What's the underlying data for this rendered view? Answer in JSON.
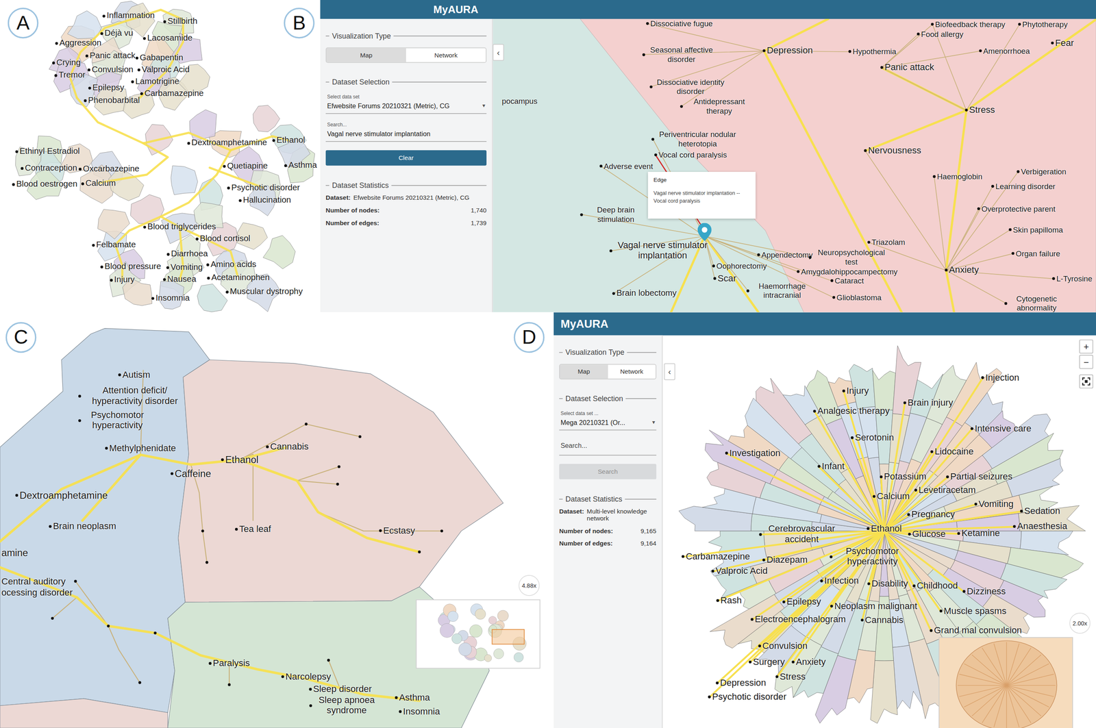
{
  "panel_a": {
    "badge": "A",
    "nodes": [
      {
        "label": "Inflammation"
      },
      {
        "label": "Stillbirth"
      },
      {
        "label": "Déjà vu"
      },
      {
        "label": "Lacosamide"
      },
      {
        "label": "Aggression"
      },
      {
        "label": "Panic attack"
      },
      {
        "label": "Gabapentin"
      },
      {
        "label": "Crying"
      },
      {
        "label": "Convulsion"
      },
      {
        "label": "Valproic Acid"
      },
      {
        "label": "Tremor"
      },
      {
        "label": "Lamotrigine"
      },
      {
        "label": "Epilepsy"
      },
      {
        "label": "Carbamazepine"
      },
      {
        "label": "Phenobarbital"
      },
      {
        "label": "Dextroamphetamine"
      },
      {
        "label": "Ethanol"
      },
      {
        "label": "Ethinyl Estradiol"
      },
      {
        "label": "Quetiapine"
      },
      {
        "label": "Asthma"
      },
      {
        "label": "Contraception"
      },
      {
        "label": "Oxcarbazepine"
      },
      {
        "label": "Blood oestrogen"
      },
      {
        "label": "Calcium"
      },
      {
        "label": "Psychotic disorder"
      },
      {
        "label": "Hallucination"
      },
      {
        "label": "Blood triglycerides"
      },
      {
        "label": "Blood cortisol"
      },
      {
        "label": "Felbamate"
      },
      {
        "label": "Diarrhoea"
      },
      {
        "label": "Amino acids"
      },
      {
        "label": "Blood pressure"
      },
      {
        "label": "Vomiting"
      },
      {
        "label": "Injury"
      },
      {
        "label": "Nausea"
      },
      {
        "label": "Acetaminophen"
      },
      {
        "label": "Insomnia"
      },
      {
        "label": "Muscular dystrophy"
      }
    ]
  },
  "panel_b": {
    "badge": "B",
    "header": {
      "title": "MyAURA"
    },
    "collapse_icon": "‹",
    "sidebar": {
      "visualization": {
        "legend": "Visualization Type",
        "tabs": [
          {
            "label": "Map",
            "selected": true
          },
          {
            "label": "Network",
            "selected": false
          }
        ]
      },
      "dataset": {
        "legend": "Dataset Selection",
        "select_label": "Select data set",
        "select_value": "Efwebsite Forums 20210321 (Metric), CG",
        "select_arrow": "▾",
        "search_label": "Search...",
        "search_value": "Vagal nerve stimulator implantation",
        "button": {
          "label": "Clear",
          "disabled": false
        }
      },
      "stats": {
        "legend": "Dataset Statistics",
        "rows": [
          {
            "label": "Dataset:",
            "value": "Efwebsite Forums 20210321 (Metric), CG"
          },
          {
            "label": "Number of nodes:",
            "value": "1,740"
          },
          {
            "label": "Number of edges:",
            "value": "1,739"
          }
        ]
      }
    },
    "map": {
      "nodes": [
        {
          "label": "pocampus"
        },
        {
          "label": "Dissociative fugue"
        },
        {
          "label": "Seasonal affective disorder"
        },
        {
          "label": "Depression"
        },
        {
          "label": "Hypothermia"
        },
        {
          "label": "Biofeedback therapy"
        },
        {
          "label": "Food allergy"
        },
        {
          "label": "Phytotherapy"
        },
        {
          "label": "Panic attack"
        },
        {
          "label": "Amenorrhoea"
        },
        {
          "label": "Fear"
        },
        {
          "label": "Dissociative identity disorder"
        },
        {
          "label": "Antidepressant therapy"
        },
        {
          "label": "Stress"
        },
        {
          "label": "Nervousness"
        },
        {
          "label": "Periventricular nodular heterotopia"
        },
        {
          "label": "Vocal cord paralysis"
        },
        {
          "label": "Adverse event"
        },
        {
          "label": "Haemoglobin"
        },
        {
          "label": "Verbigeration"
        },
        {
          "label": "Learning disorder"
        },
        {
          "label": "Overprotective parent"
        },
        {
          "label": "Deep brain stimulation"
        },
        {
          "label": "Skin papilloma"
        },
        {
          "label": "Organ failure"
        },
        {
          "label": "Vagal nerve stimulator implantation"
        },
        {
          "label": "Appendectomy"
        },
        {
          "label": "Neuropsychological test"
        },
        {
          "label": "Triazolam"
        },
        {
          "label": "Oophorectomy"
        },
        {
          "label": "Amygdalohippocampectomy"
        },
        {
          "label": "Anxiety"
        },
        {
          "label": "L-Tyrosine"
        },
        {
          "label": "Scar"
        },
        {
          "label": "Haemorrhage intracranial"
        },
        {
          "label": "Cataract"
        },
        {
          "label": "Brain lobectomy"
        },
        {
          "label": "Glioblastoma"
        },
        {
          "label": "Cytogenetic abnormality"
        }
      ],
      "tooltip": {
        "title": "Edge",
        "text": "Vagal nerve stimulator implantation -- Vocal cord paralysis"
      }
    }
  },
  "panel_c": {
    "badge": "C",
    "zoom": "4.88x",
    "nodes": [
      {
        "label": "Autism"
      },
      {
        "label": "Attention deficit/ hyperactivity disorder"
      },
      {
        "label": "Psychomotor hyperactivity"
      },
      {
        "label": "Methylphenidate"
      },
      {
        "label": "Dextroamphetamine"
      },
      {
        "label": "Brain neoplasm"
      },
      {
        "label": "amine"
      },
      {
        "label": "Central auditory"
      },
      {
        "label": "ocessing disorder"
      },
      {
        "label": "Cannabis"
      },
      {
        "label": "Ethanol"
      },
      {
        "label": "Caffeine"
      },
      {
        "label": "Tea leaf"
      },
      {
        "label": "Ecstasy"
      },
      {
        "label": "Paralysis"
      },
      {
        "label": "Narcolepsy"
      },
      {
        "label": "Sleep disorder"
      },
      {
        "label": "Sleep apnoea syndrome"
      },
      {
        "label": "Asthma"
      },
      {
        "label": "Insomnia"
      }
    ]
  },
  "panel_d": {
    "badge": "D",
    "header": {
      "title": "MyAURA"
    },
    "collapse_icon": "‹",
    "sidebar": {
      "visualization": {
        "legend": "Visualization Type",
        "tabs": [
          {
            "label": "Map",
            "selected": true
          },
          {
            "label": "Network",
            "selected": false
          }
        ]
      },
      "dataset": {
        "legend": "Dataset Selection",
        "select_label": "Select data set ...",
        "select_value": "Mega 20210321 (Or...",
        "select_arrow": "▾",
        "search_placeholder": "Search...",
        "button": {
          "label": "Search",
          "disabled": true
        }
      },
      "stats": {
        "legend": "Dataset Statistics",
        "rows": [
          {
            "label": "Dataset:",
            "value": "Multi-level knowledge network"
          },
          {
            "label": "Number of nodes:",
            "value": "9,165"
          },
          {
            "label": "Number of edges:",
            "value": "9,164"
          }
        ]
      }
    },
    "map": {
      "controls": [
        {
          "label": "+"
        },
        {
          "label": "−"
        }
      ],
      "zoom": "2.00x",
      "nodes": [
        {
          "label": "Injection"
        },
        {
          "label": "Injury"
        },
        {
          "label": "Brain injury"
        },
        {
          "label": "Analgesic therapy"
        },
        {
          "label": "Intensive care"
        },
        {
          "label": "Serotonin"
        },
        {
          "label": "Investigation"
        },
        {
          "label": "Lidocaine"
        },
        {
          "label": "Infant"
        },
        {
          "label": "Potassium"
        },
        {
          "label": "Partial seizures"
        },
        {
          "label": "Levetiracetam"
        },
        {
          "label": "Calcium"
        },
        {
          "label": "Vomiting"
        },
        {
          "label": "Sedation"
        },
        {
          "label": "Pregnancy"
        },
        {
          "label": "Anaesthesia"
        },
        {
          "label": "Cerebrovascular accident"
        },
        {
          "label": "Ethanol"
        },
        {
          "label": "Glucose"
        },
        {
          "label": "Ketamine"
        },
        {
          "label": "Psychomotor hyperactivity"
        },
        {
          "label": "Carbamazepine"
        },
        {
          "label": "Diazepam"
        },
        {
          "label": "Valproic Acid"
        },
        {
          "label": "Infection"
        },
        {
          "label": "Disability"
        },
        {
          "label": "Childhood"
        },
        {
          "label": "Dizziness"
        },
        {
          "label": "Rash"
        },
        {
          "label": "Epilepsy"
        },
        {
          "label": "Neoplasm malignant"
        },
        {
          "label": "Muscle spasms"
        },
        {
          "label": "Electroencephalogram"
        },
        {
          "label": "Cannabis"
        },
        {
          "label": "Grand mal convulsion"
        },
        {
          "label": "Convulsion"
        },
        {
          "label": "Surgery"
        },
        {
          "label": "Anxiety"
        },
        {
          "label": "Stress"
        },
        {
          "label": "Depression"
        },
        {
          "label": "Psychotic disorder"
        }
      ]
    }
  }
}
